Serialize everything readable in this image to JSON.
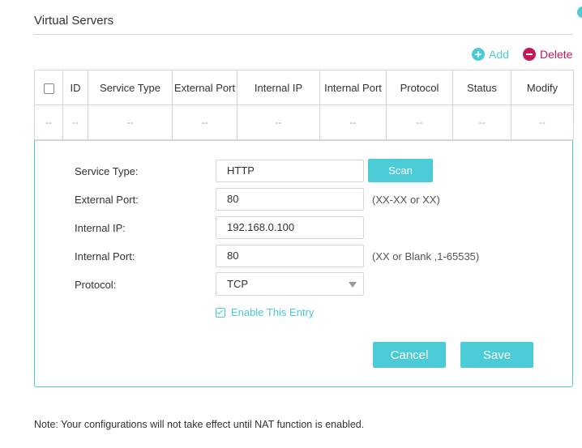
{
  "section_title": "Virtual Servers",
  "actions": {
    "add": "Add",
    "delete": "Delete"
  },
  "table": {
    "headers": [
      "ID",
      "Service Type",
      "External Port",
      "Internal IP",
      "Internal Port",
      "Protocol",
      "Status",
      "Modify"
    ],
    "row": [
      "--",
      "--",
      "--",
      "--",
      "--",
      "--",
      "--",
      "--",
      "--"
    ]
  },
  "form": {
    "service_type": {
      "label": "Service Type:",
      "value": "HTTP",
      "scan_label": "Scan"
    },
    "external_port": {
      "label": "External Port:",
      "value": "80",
      "hint": "(XX-XX or XX)"
    },
    "internal_ip": {
      "label": "Internal IP:",
      "value": "192.168.0.100"
    },
    "internal_port": {
      "label": "Internal Port:",
      "value": "80",
      "hint": "(XX or Blank ,1-65535)"
    },
    "protocol": {
      "label": "Protocol:",
      "value": "TCP"
    },
    "enable_entry": {
      "label": "Enable This Entry",
      "checked": true
    },
    "cancel_label": "Cancel",
    "save_label": "Save"
  },
  "note": "Note: Your configurations will not take effect until NAT function is enabled.",
  "colors": {
    "accent": "#4acbd6",
    "delete": "#c2185b"
  }
}
